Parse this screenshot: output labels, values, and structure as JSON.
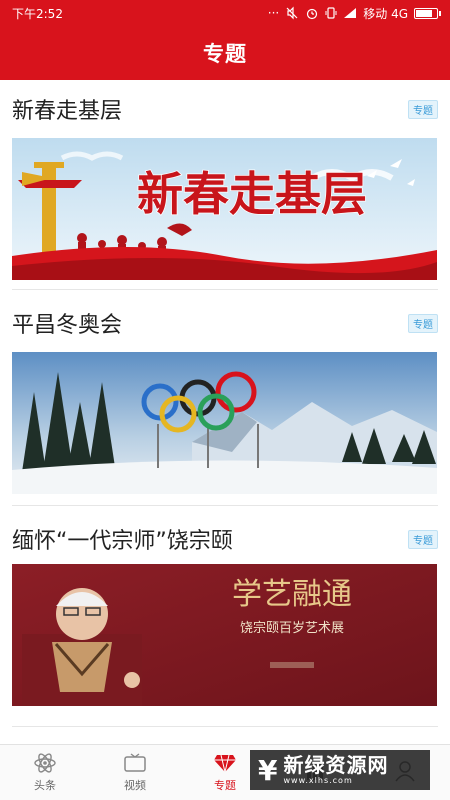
{
  "status_bar": {
    "time": "下午2:52",
    "dots": "···",
    "network": "移动 4G"
  },
  "header": {
    "title": "专题"
  },
  "cards": [
    {
      "title": "新春走基层",
      "tag": "专题",
      "banner": {
        "text": "新春走基层"
      }
    },
    {
      "title": "平昌冬奥会",
      "tag": "专题",
      "banner": {
        "text": ""
      }
    },
    {
      "title": "缅怀“一代宗师”饶宗颐",
      "tag": "专题",
      "banner": {
        "text": "学艺融通",
        "subtext": "饶宗颐百岁艺术展"
      }
    }
  ],
  "tabs": [
    {
      "label": "头条",
      "icon": "atom-icon",
      "active": false
    },
    {
      "label": "视频",
      "icon": "tv-icon",
      "active": false
    },
    {
      "label": "专题",
      "icon": "diamond-icon",
      "active": true
    },
    {
      "label": "",
      "icon": "chart-icon",
      "active": false
    },
    {
      "label": "",
      "icon": "user-icon",
      "active": false
    }
  ],
  "watermark": {
    "main": "新绿资源网",
    "sub": "www.xlhs.com"
  },
  "colors": {
    "brand_red": "#d8131c",
    "tag_blue": "#3a9bd8"
  },
  "battery_level": 0.85
}
